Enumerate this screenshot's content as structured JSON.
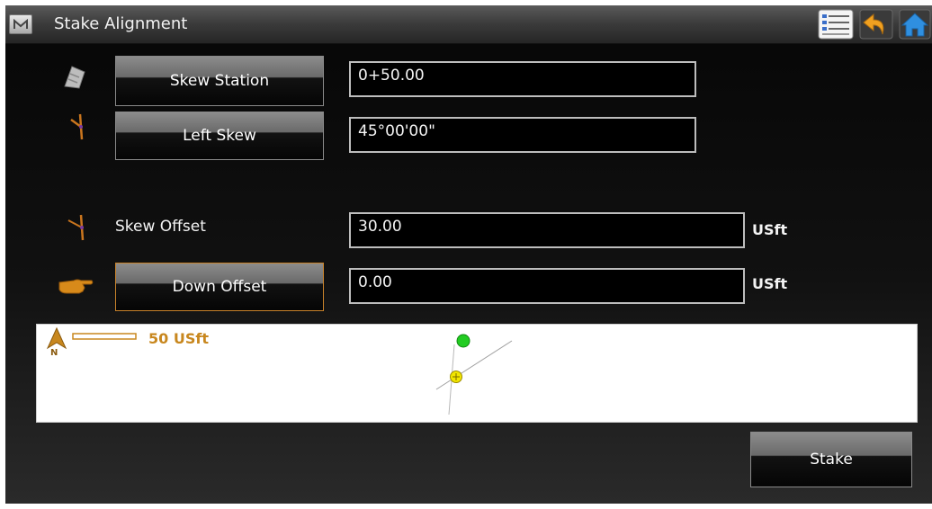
{
  "title_bar": {
    "menu_icon": "m-logo-icon",
    "title": "Stake Alignment",
    "icons": [
      "list-icon",
      "back-arrow-icon",
      "home-icon"
    ]
  },
  "form": {
    "skew_station": {
      "icon": "station-icon",
      "button_label": "Skew Station",
      "value": "0+50.00"
    },
    "left_skew": {
      "icon": "skew-angle-icon",
      "button_label": "Left Skew",
      "value": "45°00'00\""
    },
    "skew_offset": {
      "icon": "skew-offset-icon",
      "label": "Skew Offset",
      "value": "30.00",
      "unit": "USft"
    },
    "down_offset": {
      "icon": "pointing-hand-icon",
      "button_label": "Down Offset",
      "value": "0.00",
      "unit": "USft"
    }
  },
  "map": {
    "north_label": "N",
    "scale_label": "50 USft",
    "colors": {
      "target_point": "#22cc22",
      "current_point": "#f2e600",
      "north_arrow": "#c8871e"
    }
  },
  "stake_button_label": "Stake"
}
